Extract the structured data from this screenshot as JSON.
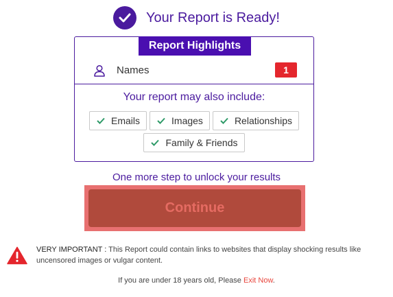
{
  "header": {
    "title": "Your Report is Ready!"
  },
  "card": {
    "tab_label": "Report Highlights",
    "names_label": "Names",
    "names_count": "1",
    "include_title": "Your report may also include:",
    "chips": [
      "Emails",
      "Images",
      "Relationships",
      "Family & Friends"
    ]
  },
  "step_text": "One more step to unlock your results",
  "continue_label": "Continue",
  "warning": {
    "label": "VERY IMPORTANT :",
    "text": " This Report could contain links to websites that display shocking results like uncensored images or vulgar content."
  },
  "footer": {
    "text": "If you are under 18 years old, Please ",
    "link": "Exit Now",
    "suffix": "."
  },
  "colors": {
    "brand": "#4a1a9e",
    "badge": "#e4262d",
    "check": "#2e9a68",
    "continue": "#b04a3c",
    "link": "#e8453c"
  },
  "icons": {
    "header": "check-circle-icon",
    "names": "user-icon",
    "chip": "checkmark-icon",
    "warning": "warning-triangle-icon"
  }
}
